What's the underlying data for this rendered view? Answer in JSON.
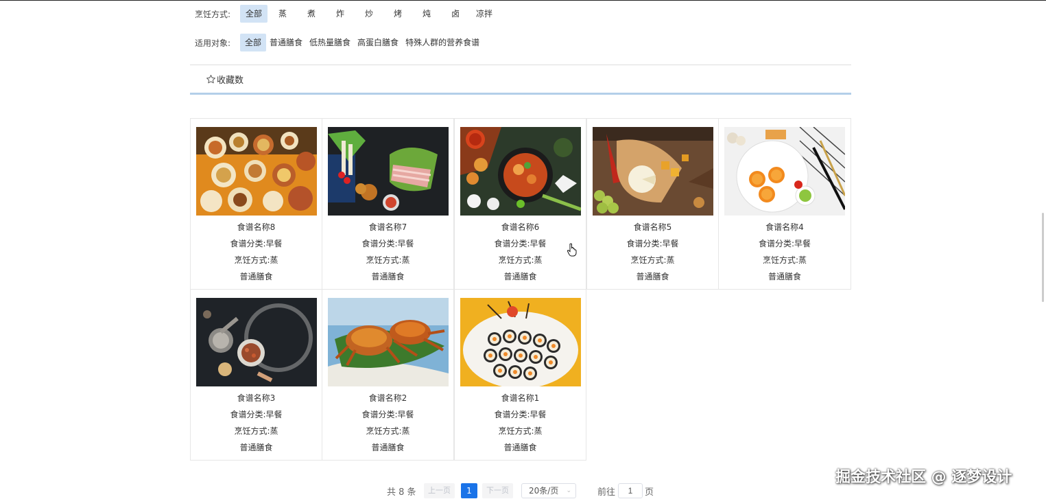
{
  "filters": {
    "cooking": {
      "label": "烹饪方式:",
      "options": [
        "全部",
        "蒸",
        "煮",
        "炸",
        "炒",
        "烤",
        "炖",
        "卤",
        "凉拌"
      ],
      "selected": "全部"
    },
    "audience": {
      "label": "适用对象:",
      "options": [
        "全部",
        "普通膳食",
        "低热量膳食",
        "高蛋白膳食",
        "特殊人群的营养食谱"
      ],
      "selected": "全部"
    }
  },
  "sort": {
    "label": "收藏数",
    "icon": "star-outline-icon"
  },
  "recipes": [
    {
      "name": "食谱名称8",
      "category": "食谱分类:早餐",
      "method": "烹饪方式:蒸",
      "type": "普通膳食",
      "image": "breakfast-dishes-photo"
    },
    {
      "name": "食谱名称7",
      "category": "食谱分类:早餐",
      "method": "烹饪方式:蒸",
      "type": "普通膳食",
      "image": "hotpot-ingredients-photo"
    },
    {
      "name": "食谱名称6",
      "category": "食谱分类:早餐",
      "method": "烹饪方式:蒸",
      "type": "普通膳食",
      "image": "seafood-stew-photo"
    },
    {
      "name": "食谱名称5",
      "category": "食谱分类:早餐",
      "method": "烹饪方式:蒸",
      "type": "普通膳食",
      "image": "cheese-platter-photo"
    },
    {
      "name": "食谱名称4",
      "category": "食谱分类:早餐",
      "method": "烹饪方式:蒸",
      "type": "普通膳食",
      "image": "pastry-plate-photo"
    },
    {
      "name": "食谱名称3",
      "category": "食谱分类:早餐",
      "method": "烹饪方式:蒸",
      "type": "普通膳食",
      "image": "dark-flour-spices-photo"
    },
    {
      "name": "食谱名称2",
      "category": "食谱分类:早餐",
      "method": "烹饪方式:蒸",
      "type": "普通膳食",
      "image": "crabs-photo"
    },
    {
      "name": "食谱名称1",
      "category": "食谱分类:早餐",
      "method": "烹饪方式:蒸",
      "type": "普通膳食",
      "image": "sushi-rolls-photo"
    }
  ],
  "pagination": {
    "total": "共 8 条",
    "prev": "上一页",
    "page": "1",
    "next": "下一页",
    "page_size": "20条/页",
    "goto_label": "前往",
    "goto_value": "1",
    "goto_unit": "页"
  },
  "watermark": "掘金技术社区 @ 逐梦设计",
  "colors": {
    "accent": "#1a73e8",
    "active_filter": "#d2e3f5",
    "sort_underline": "#b3cfe9"
  }
}
